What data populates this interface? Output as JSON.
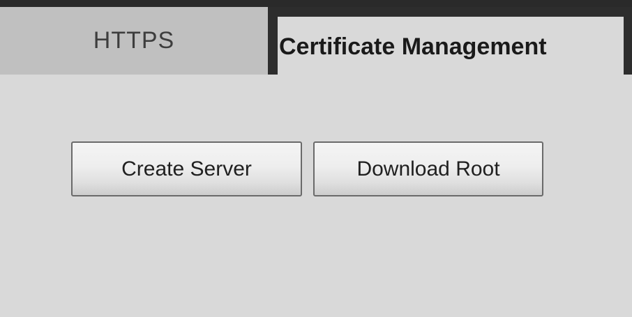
{
  "tabs": [
    {
      "label": "HTTPS",
      "active": false
    },
    {
      "label": "Certificate Management",
      "active": true
    }
  ],
  "actions": {
    "create_server_label": "Create Server",
    "download_root_label": "Download Root"
  },
  "colors": {
    "background": "#d9d9d9",
    "inactive_tab": "#c0c0c0",
    "tab_border": "#2d2d2d"
  }
}
